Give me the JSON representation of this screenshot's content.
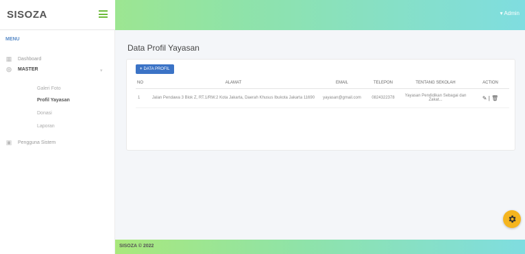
{
  "brand": {
    "name": "SISOZA"
  },
  "topbar": {
    "user": "Admin"
  },
  "sidebar": {
    "header": "MENU",
    "items": [
      {
        "label": "Dashboard",
        "icon": "dashboard-icon"
      },
      {
        "label": "MASTER",
        "icon": "master-icon"
      },
      {
        "label": "Pengguna Sistem",
        "icon": "users-icon"
      }
    ],
    "sub_items": [
      {
        "label": "Galeri Foto"
      },
      {
        "label": "Profil Yayasan"
      },
      {
        "label": "Donasi"
      },
      {
        "label": "Laporan"
      }
    ]
  },
  "main": {
    "title": "Data Profil Yayasan",
    "add_button": "DATA PROFIL",
    "table": {
      "headers": [
        "NO",
        "ALAMAT",
        "EMAIL",
        "TELEPON",
        "TENTANG SEKOLAH",
        "ACTION"
      ],
      "rows": [
        {
          "no": "1",
          "alamat": "Jalan Pendawa 3 Blok Z, RT.1/RW.2 Kota Jakarta, Daerah Khusus Ibukota Jakarta 11690",
          "email": "yayasan@gmail.com",
          "telepon": "0824322378",
          "tentang": "Yayasan Pendidikan Sebagai dan Zakat..."
        }
      ]
    }
  },
  "footer": {
    "text": "SISOZA © 2022"
  },
  "colors": {
    "accent": "#3b73c6",
    "gradient_start": "#a9e87c",
    "gradient_end": "#7fdde0",
    "fab": "#f5b51f"
  }
}
